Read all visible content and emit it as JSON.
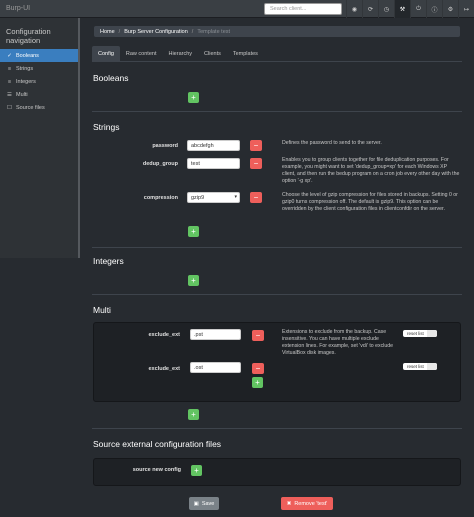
{
  "navbar": {
    "brand": "Burp-UI",
    "search_placeholder": "Search client...",
    "icons": [
      "dashboard-icon",
      "refresh-icon",
      "clock-icon",
      "wrench-icon",
      "power-icon",
      "info-icon",
      "settings-icon",
      "logout-icon"
    ]
  },
  "sidebar": {
    "title": "Configuration navigation",
    "items": [
      {
        "label": "Booleans",
        "icon": "check-icon"
      },
      {
        "label": "Strings",
        "icon": "text-icon"
      },
      {
        "label": "Integers",
        "icon": "number-icon"
      },
      {
        "label": "Multi",
        "icon": "list-icon"
      },
      {
        "label": "Source files",
        "icon": "file-icon"
      }
    ]
  },
  "breadcrumb": {
    "home": "Home",
    "server_config": "Burp Server Configuration",
    "current": "Template test"
  },
  "tabs": [
    "Config",
    "Raw content",
    "Hierarchy",
    "Clients",
    "Templates"
  ],
  "sections": {
    "booleans": "Booleans",
    "strings": "Strings",
    "integers": "Integers",
    "multi": "Multi",
    "source": "Source external configuration files"
  },
  "strings": {
    "password": {
      "label": "password",
      "value": "abcdefgh",
      "help": "Defines the password to send to the server."
    },
    "dedup_group": {
      "label": "dedup_group",
      "value": "test",
      "help": "Enables you to group clients together for file deduplication purposes. For example, you might want to set 'dedup_group=xp' for each Windows XP client, and then run the bedup program on a cron job every other day with the option '-g xp'."
    },
    "compression": {
      "label": "compression",
      "value": "gzip9",
      "help": "Choose the level of gzip compression for files stored in backups. Setting 0 or gzip0 turns compression off. The default is gzip9. This option can be overridden by the client configuration files in clientconfdir on the server."
    }
  },
  "multi": {
    "label": "exclude_ext",
    "values": [
      ".pst",
      ".ost"
    ],
    "help": "Extensions to exclude from the backup. Case insensitive. You can have multiple exclude extension lines. For example, set 'vdi' to exclude VirtualBox disk images.",
    "reset_label": "reset list"
  },
  "source": {
    "label": "source new config"
  },
  "buttons": {
    "add": "+",
    "delete": "−",
    "save": "Save",
    "remove": "Remove 'test'",
    "save_icon": "save-icon",
    "remove_icon": "trash-icon"
  }
}
